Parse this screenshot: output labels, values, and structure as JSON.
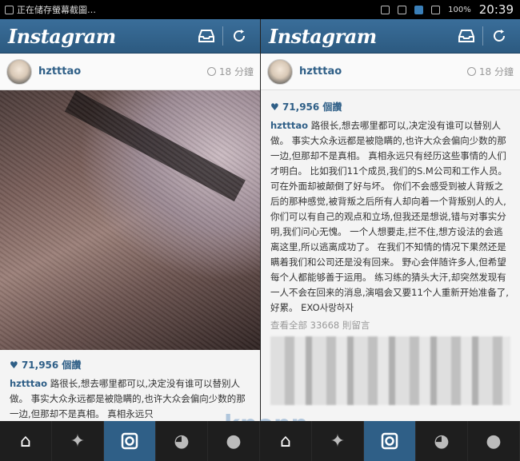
{
  "status": {
    "left_text": "正在储存螢幕截圖…",
    "battery": "100%",
    "clock": "20:39"
  },
  "app": {
    "title": "Instagram"
  },
  "post": {
    "username": "hztttao",
    "time": "18 分鐘",
    "likes": "71,956 個讚",
    "caption_user": "hztttao",
    "caption_left": "路很长,想去哪里都可以,决定没有谁可以替别人做。 事实大众永远都是被隐瞒的,也许大众会偏向少数的那一边,但那却不是真相。 真相永远只",
    "caption_right": "路很长,想去哪里都可以,决定没有谁可以替别人做。 事实大众永远都是被隐瞒的,也许大众会偏向少数的那一边,但那却不是真相。 真相永远只有经历这些事情的人们才明白。 比如我们11个成员,我们的S.M公司和工作人员。 可在外面却被颠倒了好与坏。 你们不会感受到被人背叛之后的那种感觉,被背叛之后所有人却向着一个背叛别人的人,你们可以有自己的观点和立场,但我还是想说,错与对事实分明,我们问心无愧。 一个人想要走,拦不住,想方设法的会逃离这里,所以逃离成功了。 在我们不知情的情况下果然还是瞒着我们和公司还是没有回来。 野心会伴随许多人,但希望每个人都能够善于运用。 练习练的猜头大汗,却突然发现有一人不会在回来的消息,演唱会又要11个人重新开始准备了,好累。 EXO사랑하자",
    "view_all": "查看全部 33668 則留言"
  },
  "watermark": "kpopn",
  "icons": {
    "inbox": "inbox-icon",
    "refresh": "refresh-icon",
    "home": "home-icon",
    "explore": "explore-icon",
    "camera": "camera-icon",
    "activity": "activity-icon",
    "profile": "profile-icon"
  },
  "colors": {
    "brand": "#2f5f87",
    "nav_bg": "#1e1e1e"
  }
}
